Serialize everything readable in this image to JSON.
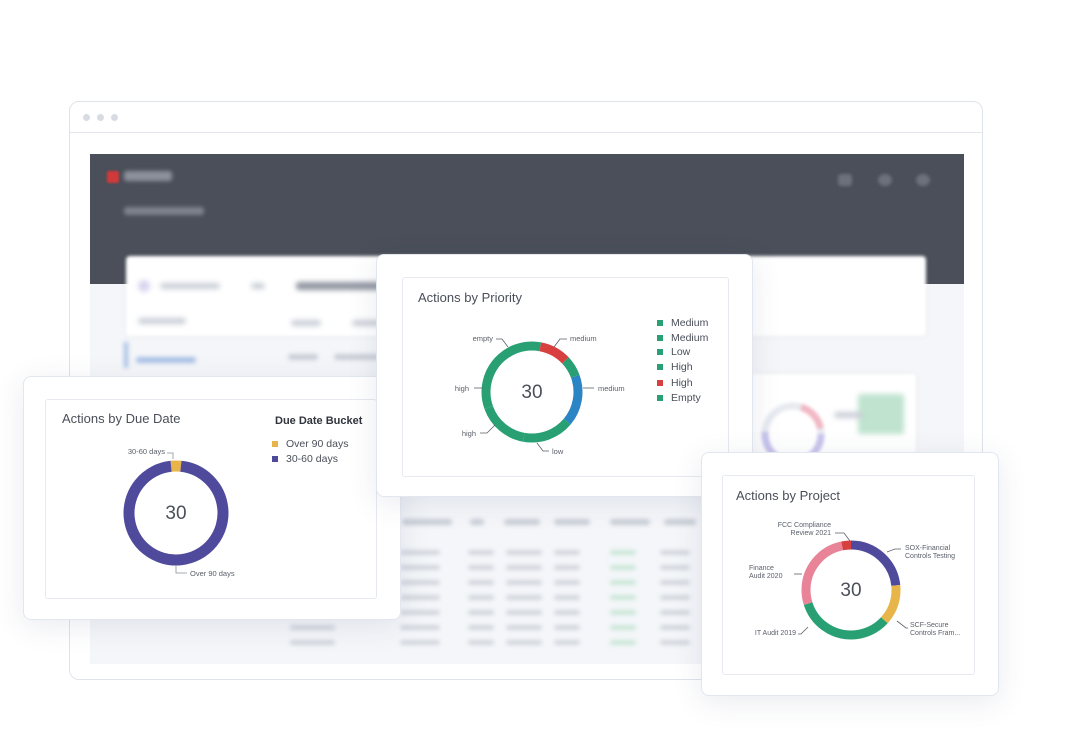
{
  "due_date_card": {
    "title": "Actions by Due Date",
    "legend_title": "Due Date Bucket",
    "legend": [
      {
        "label": "Over 90 days",
        "color": "#e8b54a"
      },
      {
        "label": "30-60 days",
        "color": "#4f4a9c"
      }
    ],
    "total": "30",
    "labels": {
      "top": "30-60 days",
      "bottom": "Over 90 days"
    }
  },
  "priority_card": {
    "title": "Actions by Priority",
    "legend": [
      {
        "label": "Medium",
        "color": "#28a074"
      },
      {
        "label": "Medium",
        "color": "#28a074"
      },
      {
        "label": "Low",
        "color": "#28a074"
      },
      {
        "label": "High",
        "color": "#28a074"
      },
      {
        "label": "High",
        "color": "#d8403f"
      },
      {
        "label": "Empty",
        "color": "#28a074"
      }
    ],
    "total": "30",
    "labels": {
      "empty": "empty",
      "medium_top": "medium",
      "high_top": "high",
      "medium_right": "medium",
      "high_bottom": "high",
      "low": "low"
    }
  },
  "project_card": {
    "title": "Actions by Project",
    "total": "30",
    "labels": {
      "fcc_1": "FCC Compliance",
      "fcc_2": "Review 2021",
      "sox_1": "SOX-Financial",
      "sox_2": "Controls Testing",
      "fin_1": "Finance",
      "fin_2": "Audit 2020",
      "scf_1": "SCF-Secure",
      "scf_2": "Controls Fram...",
      "it": "IT Audit 2019"
    }
  },
  "chart_data": [
    {
      "type": "pie",
      "title": "Actions by Due Date",
      "total": 30,
      "categories": [
        "30-60 days",
        "Over 90 days"
      ],
      "values": [
        1,
        29
      ],
      "colors": [
        "#e8b54a",
        "#4f4a9c"
      ]
    },
    {
      "type": "pie",
      "title": "Actions by Priority",
      "total": 30,
      "categories": [
        "medium",
        "medium",
        "low",
        "high",
        "high",
        "empty"
      ],
      "values": [
        5,
        5,
        5,
        10,
        3,
        2
      ],
      "colors": [
        "#2b84c4",
        "#28a074",
        "#28a074",
        "#28a074",
        "#d8403f",
        "#28a074"
      ]
    },
    {
      "type": "pie",
      "title": "Actions by Project",
      "total": 30,
      "categories": [
        "SOX-Financial Controls Testing",
        "SCF-Secure Controls Fram...",
        "IT Audit 2019",
        "Finance Audit 2020",
        "FCC Compliance Review 2021"
      ],
      "values": [
        7,
        4,
        10,
        8,
        1
      ],
      "colors": [
        "#4f4a9c",
        "#e8b54a",
        "#28a074",
        "#e88398",
        "#d8403f"
      ]
    }
  ]
}
